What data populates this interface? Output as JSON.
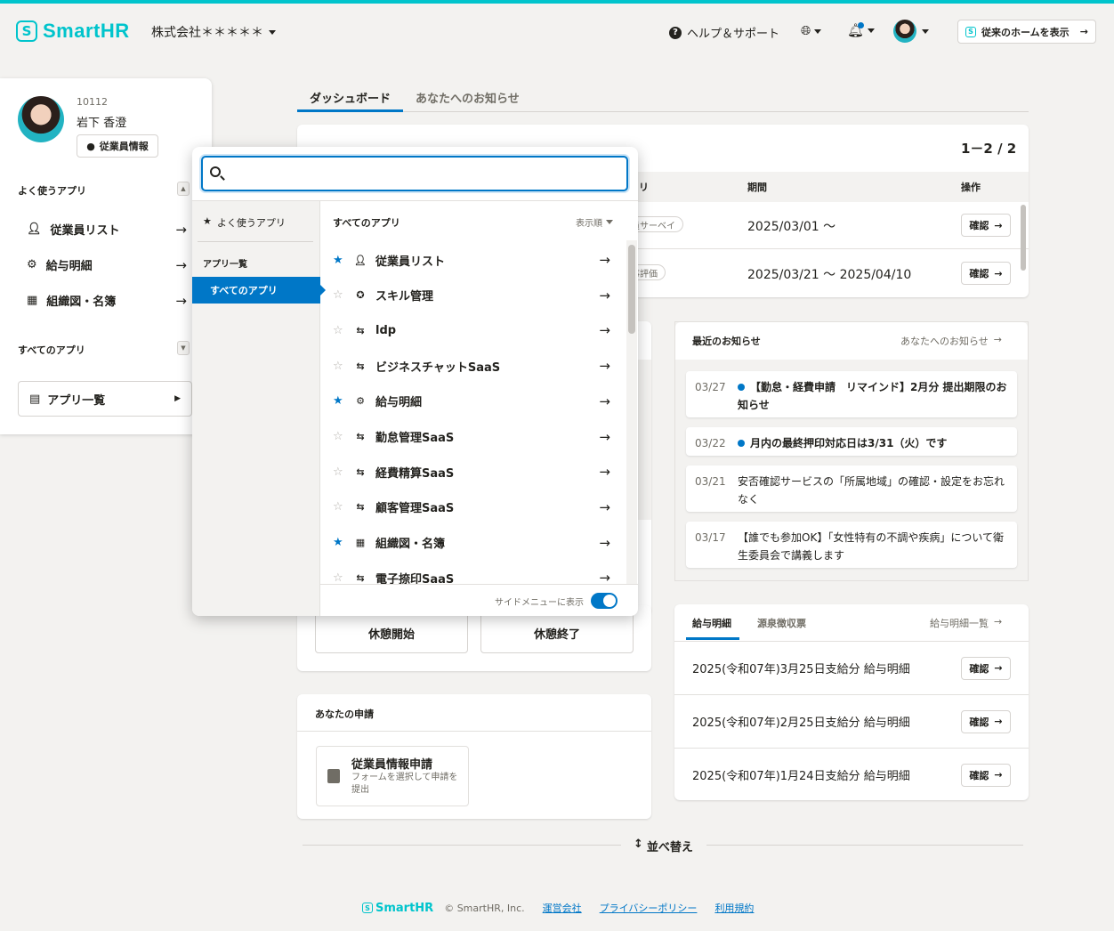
{
  "header": {
    "logo_text": "SmartHR",
    "company": "株式会社＊＊＊＊＊",
    "help": "ヘルプ＆サポート",
    "classic_home": "従来のホームを表示"
  },
  "profile": {
    "employee_no": "10112",
    "name": "岩下 香澄",
    "info_button": "従業員情報"
  },
  "sidebar": {
    "frequent_label": "よく使うアプリ",
    "items": [
      {
        "label": "従業員リスト",
        "icon": "person-icon"
      },
      {
        "label": "給与明細",
        "icon": "gear-icon"
      },
      {
        "label": "組織図・名簿",
        "icon": "org-chart-icon"
      }
    ],
    "all_apps_label": "すべてのアプリ",
    "app_list_button": "アプリ一覧"
  },
  "tabs": [
    "ダッシュボード",
    "あなたへのお知らせ"
  ],
  "tasks": {
    "count": "1－2 / 2",
    "columns": {
      "app": "リ",
      "period": "期間",
      "action": "操作"
    },
    "rows": [
      {
        "tag": "員サーベイ",
        "period": "2025/03/01 〜",
        "action": "確認"
      },
      {
        "tag": "事評価",
        "period": "2025/03/21 〜 2025/04/10",
        "action": "確認"
      }
    ]
  },
  "news": {
    "title": "最近のお知らせ",
    "link": "あなたへのお知らせ",
    "items": [
      {
        "date": "03/27",
        "unread": true,
        "text": "【勤怠・経費申請　リマインド】2月分 提出期限のお知らせ"
      },
      {
        "date": "03/22",
        "unread": true,
        "text": "月内の最終押印対応日は3/31（火）です"
      },
      {
        "date": "03/21",
        "unread": false,
        "text": "安否確認サービスの「所属地域」の確認・設定をお忘れなく"
      },
      {
        "date": "03/17",
        "unread": false,
        "text": "【誰でも参加OK】「女性特有の不調や疾病」について衛生委員会で講義します"
      }
    ]
  },
  "payslip": {
    "tabs": [
      "給与明細",
      "源泉徴収票"
    ],
    "link": "給与明細一覧",
    "rows": [
      {
        "label": "2025(令和07年)3月25日支給分 給与明細",
        "action": "確認"
      },
      {
        "label": "2025(令和07年)2月25日支給分 給与明細",
        "action": "確認"
      },
      {
        "label": "2025(令和07年)1月24日支給分 給与明細",
        "action": "確認"
      }
    ]
  },
  "attendance": {
    "break_start": "休憩開始",
    "break_end": "休憩終了"
  },
  "requests": {
    "title": "あなたの申請",
    "item_name": "従業員情報申請",
    "item_desc": "フォームを選択して申請を提出"
  },
  "sort_label": "並べ替え",
  "footer": {
    "logo": "SmartHR",
    "copyright": "© SmartHR, Inc.",
    "links": [
      "運営会社",
      "プライバシーポリシー",
      "利用規約"
    ]
  },
  "popup": {
    "search_placeholder": "",
    "favorites_label": "よく使うアプリ",
    "app_list_label": "アプリ一覧",
    "all_apps": "すべてのアプリ",
    "list_header": "すべてのアプリ",
    "sort_label": "表示順",
    "apps": [
      {
        "label": "従業員リスト",
        "starred": true,
        "icon": "person-icon"
      },
      {
        "label": "スキル管理",
        "starred": false,
        "icon": "skill-icon"
      },
      {
        "label": "ldp",
        "starred": false,
        "icon": "link-icon"
      },
      {
        "label": "ビジネスチャットSaaS",
        "starred": false,
        "icon": "link-icon"
      },
      {
        "label": "給与明細",
        "starred": true,
        "icon": "gear-icon"
      },
      {
        "label": "勤怠管理SaaS",
        "starred": false,
        "icon": "link-icon"
      },
      {
        "label": "経費精算SaaS",
        "starred": false,
        "icon": "link-icon"
      },
      {
        "label": "顧客管理SaaS",
        "starred": false,
        "icon": "link-icon"
      },
      {
        "label": "組織図・名簿",
        "starred": true,
        "icon": "org-chart-icon"
      },
      {
        "label": "電子捺印SaaS",
        "starred": false,
        "icon": "link-icon"
      }
    ],
    "side_menu_toggle": "サイドメニューに表示"
  },
  "colors": {
    "accent": "#0077c7",
    "brand": "#00c4cc"
  }
}
